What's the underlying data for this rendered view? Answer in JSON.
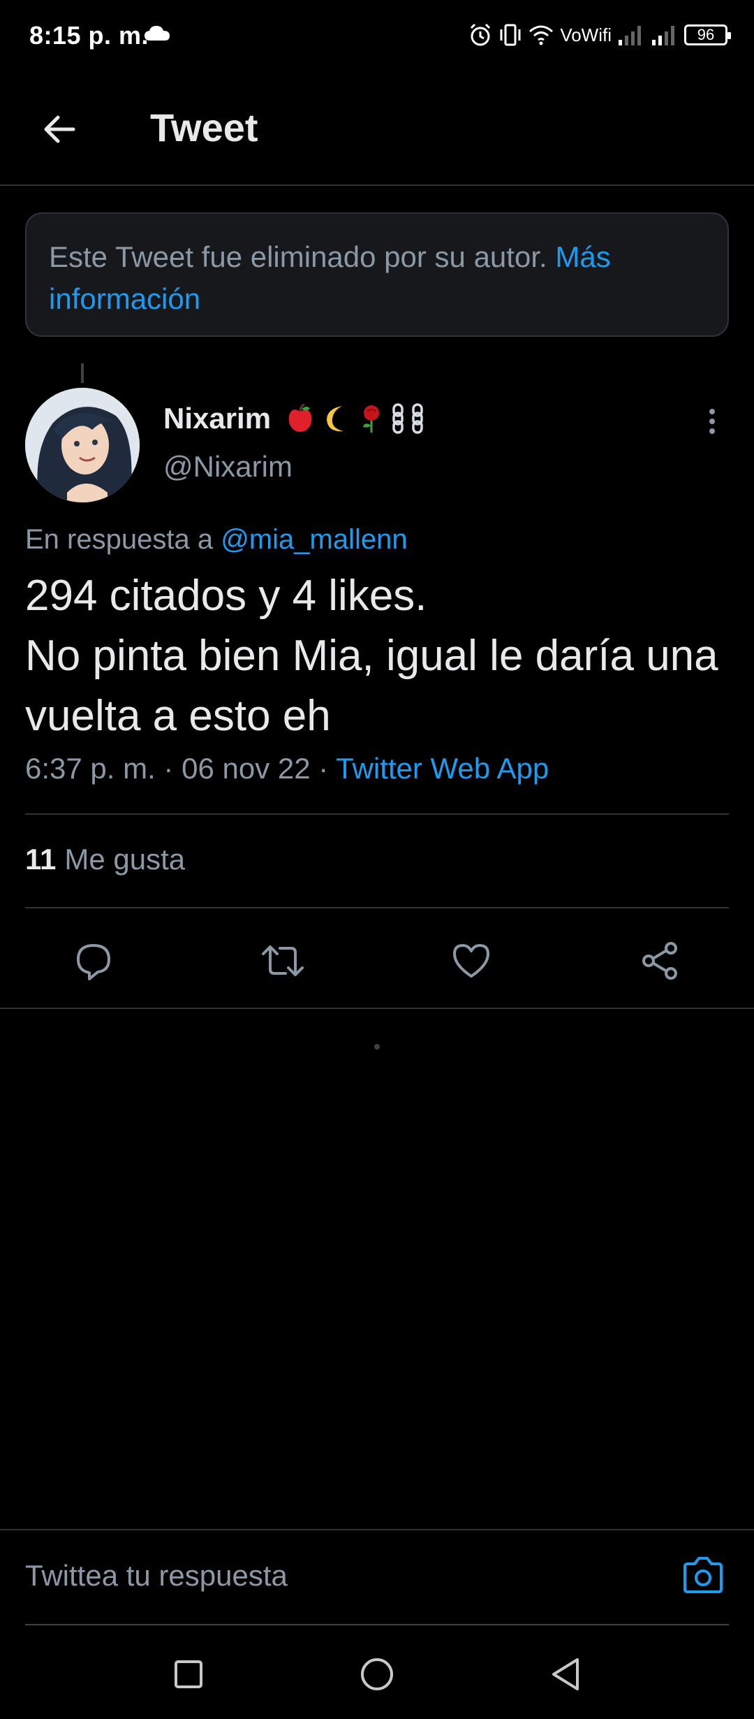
{
  "status_bar": {
    "time": "8:15 p. m.",
    "vowifi": "VoWifi",
    "battery": "96"
  },
  "header": {
    "title": "Tweet"
  },
  "deleted_notice": {
    "text": "Este Tweet fue eliminado por su autor. ",
    "link": "Más información"
  },
  "tweet": {
    "author_name": "Nixarim",
    "author_emojis": [
      "apple-emoji",
      "crescent-moon-emoji",
      "rose-emoji",
      "chains-emoji"
    ],
    "author_handle": "@Nixarim",
    "reply_prefix": "En respuesta a ",
    "reply_mention": "@mia_mallenn",
    "text_line1": "294 citados y 4 likes.",
    "text_line2": "No pinta bien Mia, igual le daría una vuelta a esto eh",
    "time": "6:37 p. m.",
    "date": "06 nov 22",
    "separator": " · ",
    "source": "Twitter Web App",
    "likes_count": "11",
    "likes_label": "Me gusta"
  },
  "actions": [
    "reply-icon",
    "retweet-icon",
    "like-icon",
    "share-icon"
  ],
  "composer": {
    "placeholder": "Twittea tu respuesta"
  },
  "colors": {
    "background": "#000000",
    "accent": "#1d9bf0",
    "text_primary": "#e7e9ea",
    "text_secondary": "#8b98a5",
    "divider": "#2f3336"
  }
}
